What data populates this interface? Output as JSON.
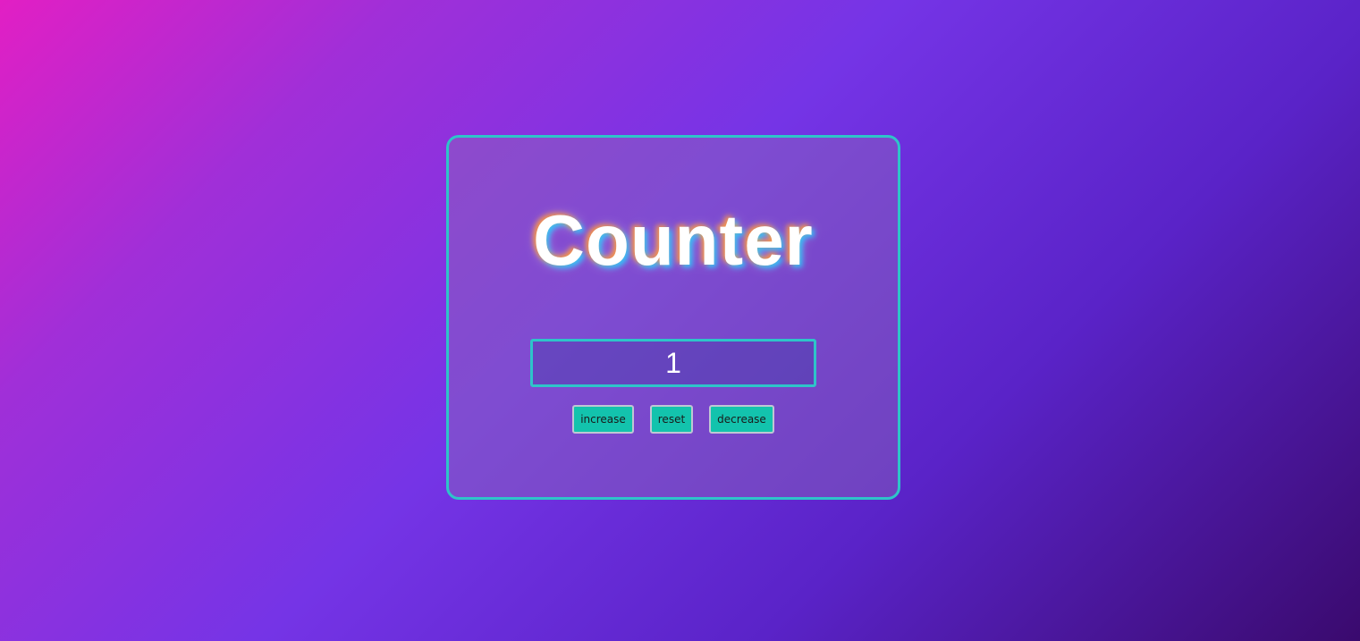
{
  "counter": {
    "title": "Counter",
    "value": "1"
  },
  "buttons": {
    "increase_label": "increase",
    "reset_label": "reset",
    "decrease_label": "decrease"
  },
  "colors": {
    "background_gradient_start": "#e21fc4",
    "background_gradient_mid": "#7534e6",
    "background_gradient_end": "#3a0a6e",
    "card_border": "#2ec4c9",
    "button_fill": "#13c3ad",
    "text": "#ffffff"
  }
}
